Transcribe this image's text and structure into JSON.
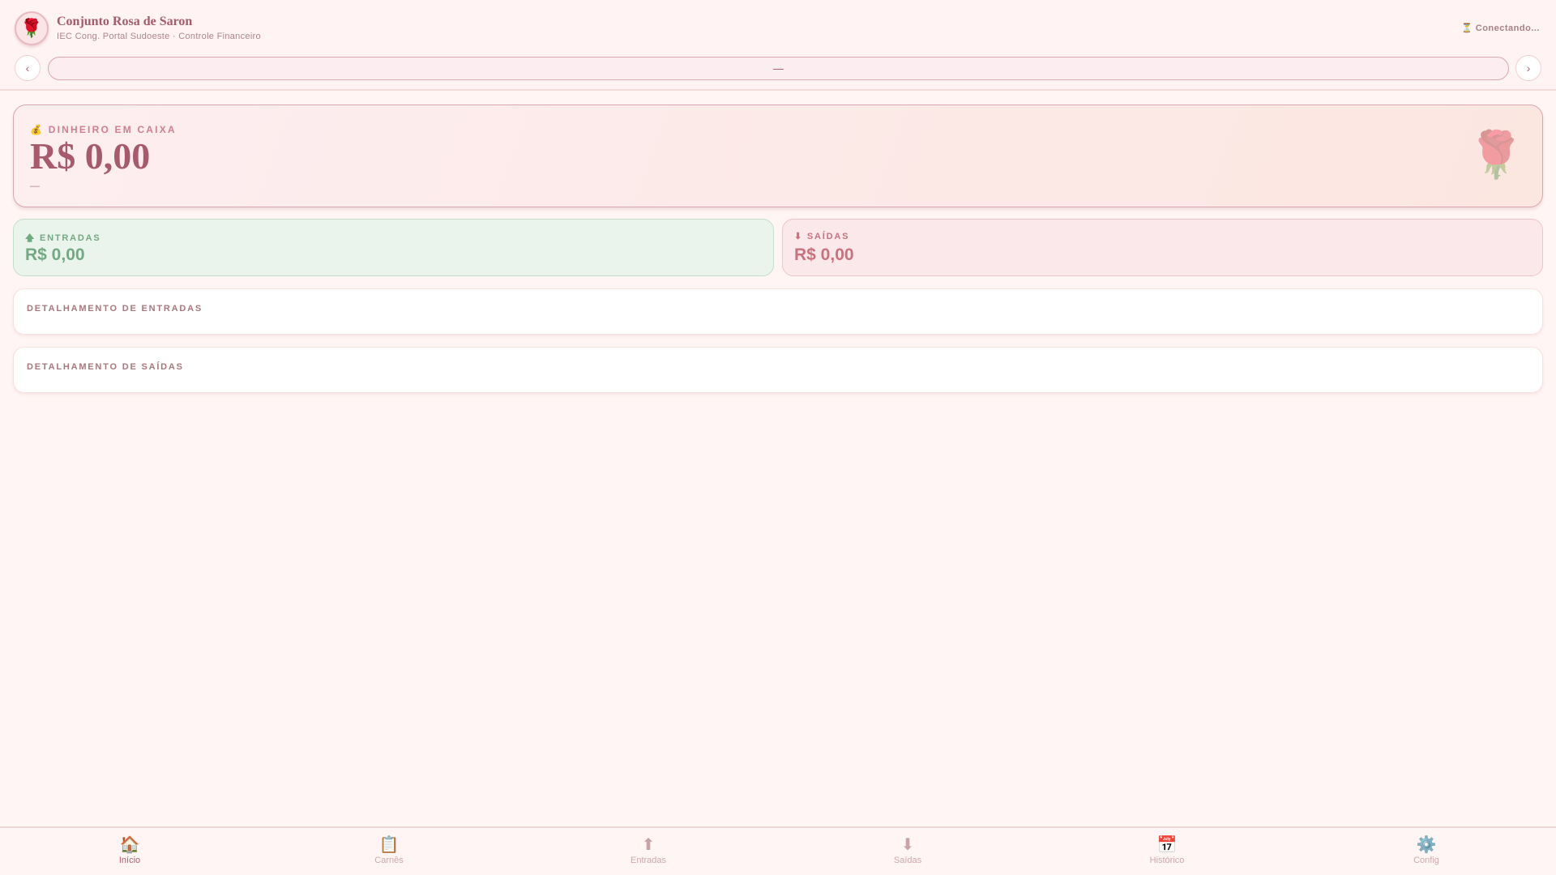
{
  "header": {
    "title": "Conjunto Rosa de Saron",
    "subtitle": "IEC Cong. Portal Sudoeste · Controle Financeiro",
    "status_icon": "⏳",
    "status": "Conectando..."
  },
  "period": {
    "prev": "‹",
    "label": "—",
    "next": "›"
  },
  "balance": {
    "icon": "💰",
    "label": "DINHEIRO EM CAIXA",
    "amount": "R$ 0,00",
    "sub": "—"
  },
  "entradas": {
    "icon": "🡅",
    "label": "ENTRADAS",
    "amount": "R$ 0,00"
  },
  "saidas": {
    "icon": "⬇",
    "label": "SAÍDAS",
    "amount": "R$ 0,00"
  },
  "details": {
    "entradas": "DETALHAMENTO DE ENTRADAS",
    "saidas": "DETALHAMENTO DE SAÍDAS"
  },
  "nav": [
    {
      "icon": "🏠",
      "label": "Início"
    },
    {
      "icon": "📋",
      "label": "Carnês"
    },
    {
      "icon": "⬆",
      "label": "Entradas"
    },
    {
      "icon": "⬇",
      "label": "Saídas"
    },
    {
      "icon": "📅",
      "label": "Histórico"
    },
    {
      "icon": "⚙️",
      "label": "Config"
    }
  ],
  "colors": {
    "accent": "#a75a6c",
    "green": "#72a982",
    "red": "#c8727e"
  }
}
